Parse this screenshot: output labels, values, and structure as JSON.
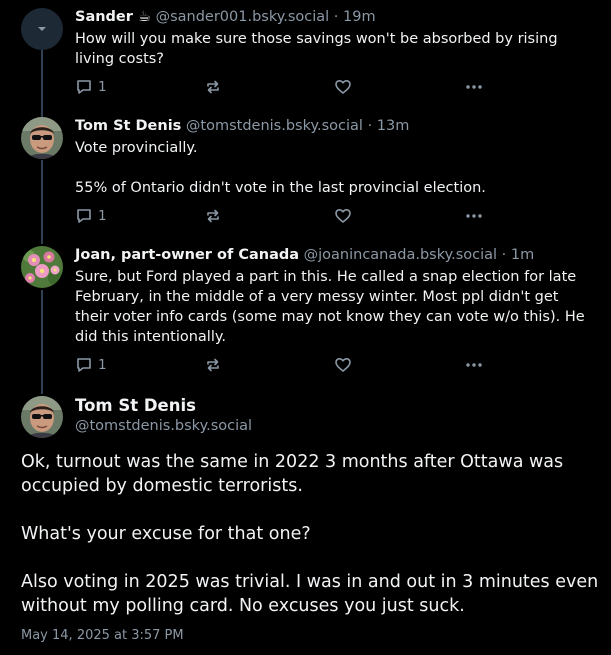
{
  "replies": [
    {
      "author": "Sander ☕",
      "handle": "@sander001.bsky.social",
      "separator": "·",
      "time": "19m",
      "paragraphs": [
        "How will you make sure those savings won't be absorbed by rising living costs?"
      ],
      "reply_count": "1",
      "avatar_icon": "collapsed-thread-chevron-icon"
    },
    {
      "author": "Tom St Denis",
      "handle": "@tomstdenis.bsky.social",
      "separator": "·",
      "time": "13m",
      "paragraphs": [
        "Vote provincially.",
        "55% of Ontario didn't vote in the last provincial election."
      ],
      "reply_count": "1",
      "avatar_icon": "man-sunglasses-avatar"
    },
    {
      "author": "Joan, part-owner of Canada",
      "handle": "@joanincanada.bsky.social",
      "separator": "·",
      "time": "1m",
      "paragraphs": [
        "Sure, but Ford played a part in this. He called a snap election for late February, in the middle of a very messy winter. Most ppl didn't get their voter info cards (some may not know they can vote w/o this). He did this intentionally."
      ],
      "reply_count": "1",
      "avatar_icon": "pink-flowers-avatar"
    }
  ],
  "main_post": {
    "author": "Tom St Denis",
    "handle": "@tomstdenis.bsky.social",
    "paragraphs": [
      "Ok, turnout was the same in 2022 3 months after Ottawa was occupied by domestic terrorists.",
      "What's your excuse for that one?",
      "Also voting in 2025 was trivial.  I was in and out in 3 minutes even without my polling card.  No excuses you just suck."
    ],
    "timestamp": "May 14, 2025 at 3:57 PM"
  },
  "colors": {
    "background": "#000000",
    "text": "#f1f3f5",
    "muted": "#8b98a5",
    "thread_line": "#2e4052"
  }
}
